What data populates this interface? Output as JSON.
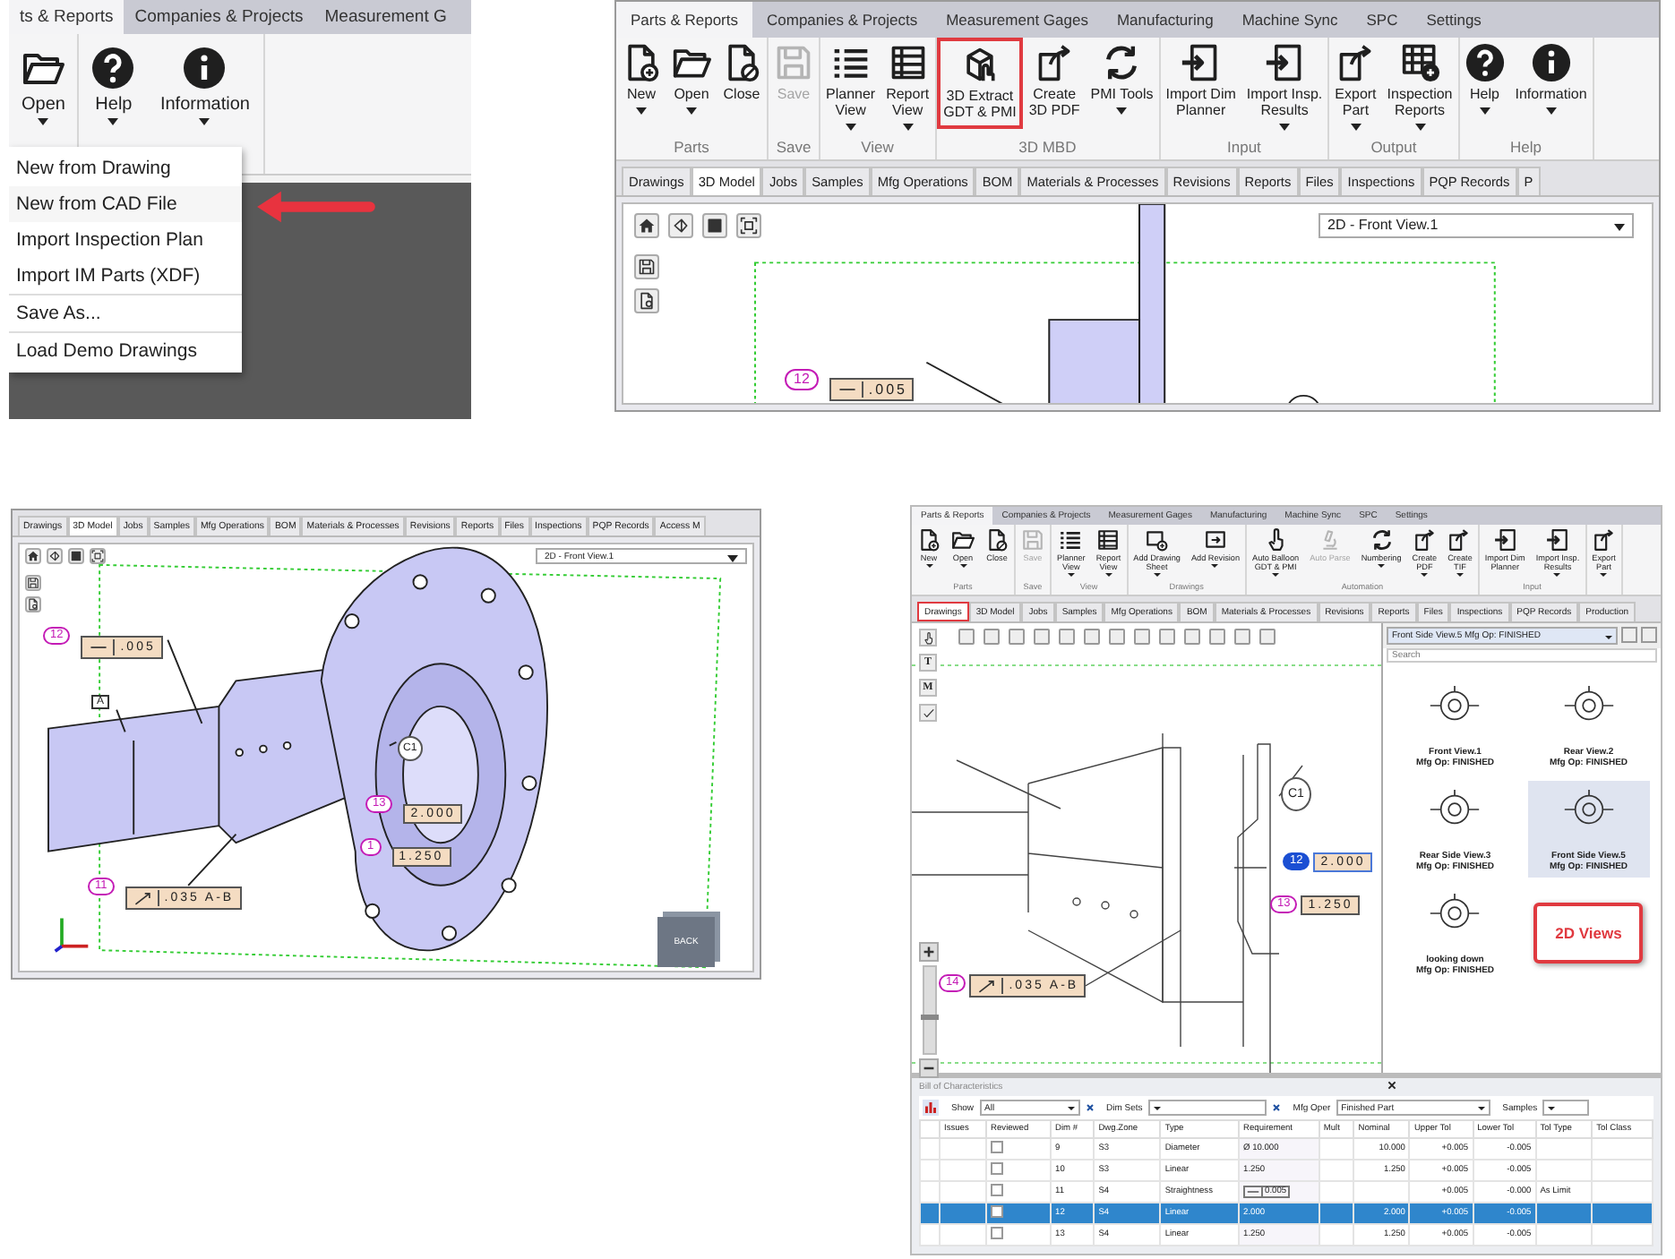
{
  "menu_panel": {
    "tabs": [
      {
        "label": "ts & Reports",
        "selected": true
      },
      {
        "label": "Companies & Projects",
        "selected": false
      },
      {
        "label": "Measurement G",
        "selected": false
      }
    ],
    "groups": [
      {
        "buttons": [
          {
            "label": "Open",
            "kind": "open",
            "caret": true
          }
        ]
      },
      {
        "buttons": [
          {
            "label": "Help",
            "kind": "help",
            "caret": true
          },
          {
            "label": "Information",
            "kind": "info",
            "caret": true
          }
        ]
      }
    ],
    "menu": [
      [
        {
          "label": "New from Drawing",
          "pointed": false
        },
        {
          "label": "New from CAD File",
          "pointed": true
        },
        {
          "label": "Import Inspection Plan",
          "pointed": false
        },
        {
          "label": "Import IM Parts (XDF)",
          "pointed": false
        }
      ],
      [
        {
          "label": "Save As...",
          "pointed": false
        }
      ],
      [
        {
          "label": "Load Demo Drawings",
          "pointed": false
        }
      ]
    ]
  },
  "ribbon_panel": {
    "tabs": [
      {
        "label": "Parts & Reports",
        "selected": true
      },
      {
        "label": "Companies & Projects",
        "selected": false
      },
      {
        "label": "Measurement Gages",
        "selected": false
      },
      {
        "label": "Manufacturing",
        "selected": false
      },
      {
        "label": "Machine Sync",
        "selected": false
      },
      {
        "label": "SPC",
        "selected": false
      },
      {
        "label": "Settings",
        "selected": false
      }
    ],
    "groups": [
      {
        "label": "Parts",
        "buttons": [
          {
            "label": "New",
            "kind": "new",
            "caret": true,
            "disabled": false,
            "highlighted": false
          },
          {
            "label": "Open",
            "kind": "open",
            "caret": true,
            "disabled": false,
            "highlighted": false
          },
          {
            "label": "Close",
            "kind": "close",
            "caret": false,
            "disabled": false,
            "highlighted": false
          }
        ]
      },
      {
        "label": "Save",
        "buttons": [
          {
            "label": "Save",
            "kind": "save",
            "caret": false,
            "disabled": true,
            "highlighted": false
          }
        ]
      },
      {
        "label": "View",
        "buttons": [
          {
            "label": "Planner\nView",
            "kind": "list",
            "caret": true,
            "disabled": false,
            "highlighted": false
          },
          {
            "label": "Report\nView",
            "kind": "table",
            "caret": true,
            "disabled": false,
            "highlighted": false
          }
        ]
      },
      {
        "label": "3D MBD",
        "buttons": [
          {
            "label": "3D Extract\nGDT & PMI",
            "kind": "cube",
            "caret": false,
            "disabled": false,
            "highlighted": true
          },
          {
            "label": "Create\n3D PDF",
            "kind": "export",
            "caret": false,
            "disabled": false,
            "highlighted": false
          },
          {
            "label": "PMI Tools",
            "kind": "cycle",
            "caret": true,
            "disabled": false,
            "highlighted": false
          }
        ]
      },
      {
        "label": "Input",
        "buttons": [
          {
            "label": "Import Dim\nPlanner",
            "kind": "import",
            "caret": false,
            "disabled": false,
            "highlighted": false
          },
          {
            "label": "Import Insp.\nResults",
            "kind": "import",
            "caret": true,
            "disabled": false,
            "highlighted": false
          }
        ]
      },
      {
        "label": "Output",
        "buttons": [
          {
            "label": "Export\nPart",
            "kind": "export",
            "caret": true,
            "disabled": false,
            "highlighted": false
          },
          {
            "label": "Inspection\nReports",
            "kind": "tableplus",
            "caret": true,
            "disabled": false,
            "highlighted": false
          }
        ]
      },
      {
        "label": "Help",
        "buttons": [
          {
            "label": "Help",
            "kind": "help",
            "caret": true,
            "disabled": false,
            "highlighted": false
          },
          {
            "label": "Information",
            "kind": "info",
            "caret": true,
            "disabled": false,
            "highlighted": false
          }
        ]
      }
    ],
    "doc_tabs": [
      {
        "label": "Drawings",
        "selected": false
      },
      {
        "label": "3D Model",
        "selected": true
      },
      {
        "label": "Jobs",
        "selected": false
      },
      {
        "label": "Samples",
        "selected": false
      },
      {
        "label": "Mfg Operations",
        "selected": false
      },
      {
        "label": "BOM",
        "selected": false
      },
      {
        "label": "Materials & Processes",
        "selected": false
      },
      {
        "label": "Revisions",
        "selected": false
      },
      {
        "label": "Reports",
        "selected": false
      },
      {
        "label": "Files",
        "selected": false
      },
      {
        "label": "Inspections",
        "selected": false
      },
      {
        "label": "PQP Records",
        "selected": false
      },
      {
        "label": "P",
        "selected": false
      }
    ],
    "view_select": "2D - Front View.1",
    "annotations": [
      {
        "balloon": "12",
        "kind": "straightness",
        "value": ".005",
        "selected": false
      }
    ]
  },
  "model_panel": {
    "doc_tabs": [
      {
        "label": "Drawings",
        "selected": false
      },
      {
        "label": "3D Model",
        "selected": true
      },
      {
        "label": "Jobs",
        "selected": false
      },
      {
        "label": "Samples",
        "selected": false
      },
      {
        "label": "Mfg Operations",
        "selected": false
      },
      {
        "label": "BOM",
        "selected": false
      },
      {
        "label": "Materials & Processes",
        "selected": false
      },
      {
        "label": "Revisions",
        "selected": false
      },
      {
        "label": "Reports",
        "selected": false
      },
      {
        "label": "Files",
        "selected": false
      },
      {
        "label": "Inspections",
        "selected": false
      },
      {
        "label": "PQP Records",
        "selected": false
      },
      {
        "label": "Access M",
        "selected": false
      }
    ],
    "view_select": "2D - Front View.1",
    "annotations": [
      {
        "balloon": "12",
        "kind": "straightness",
        "value": ".005",
        "selected": false
      },
      {
        "balloon": "13",
        "kind": "dimension",
        "value": "2.000",
        "selected": false
      },
      {
        "balloon": "1",
        "kind": "dimension",
        "value": "1.250",
        "selected": false
      },
      {
        "balloon": "11",
        "kind": "runout",
        "value": ".035 A-B",
        "selected": false
      }
    ],
    "datum": "A",
    "feature_label": "C1",
    "view_cube": "BACK"
  },
  "drawings_panel": {
    "tabs": [
      {
        "label": "Parts & Reports",
        "selected": true
      },
      {
        "label": "Companies & Projects",
        "selected": false
      },
      {
        "label": "Measurement Gages",
        "selected": false
      },
      {
        "label": "Manufacturing",
        "selected": false
      },
      {
        "label": "Machine Sync",
        "selected": false
      },
      {
        "label": "SPC",
        "selected": false
      },
      {
        "label": "Settings",
        "selected": false
      }
    ],
    "groups": [
      {
        "label": "Parts",
        "buttons": [
          {
            "label": "New",
            "kind": "new",
            "caret": true,
            "disabled": false
          },
          {
            "label": "Open",
            "kind": "open",
            "caret": true,
            "disabled": false
          },
          {
            "label": "Close",
            "kind": "close",
            "caret": false,
            "disabled": false
          }
        ]
      },
      {
        "label": "Save",
        "buttons": [
          {
            "label": "Save",
            "kind": "save",
            "caret": false,
            "disabled": true
          }
        ]
      },
      {
        "label": "View",
        "buttons": [
          {
            "label": "Planner\nView",
            "kind": "list",
            "caret": true,
            "disabled": false
          },
          {
            "label": "Report\nView",
            "kind": "table",
            "caret": true,
            "disabled": false
          }
        ]
      },
      {
        "label": "Drawings",
        "buttons": [
          {
            "label": "Add Drawing\nSheet",
            "kind": "sheet",
            "caret": true,
            "disabled": false
          },
          {
            "label": "Add Revision",
            "kind": "revision",
            "caret": true,
            "disabled": false
          }
        ]
      },
      {
        "label": "Automation",
        "buttons": [
          {
            "label": "Auto Balloon\nGDT & PMI",
            "kind": "pointer",
            "caret": true,
            "disabled": false
          },
          {
            "label": "Auto Parse",
            "kind": "microscope",
            "caret": false,
            "disabled": true
          },
          {
            "label": "Numbering",
            "kind": "cycle",
            "caret": true,
            "disabled": false
          },
          {
            "label": "Create\nPDF",
            "kind": "export",
            "caret": true,
            "disabled": false
          },
          {
            "label": "Create\nTIF",
            "kind": "export",
            "caret": true,
            "disabled": false
          }
        ]
      },
      {
        "label": "Input",
        "buttons": [
          {
            "label": "Import Dim\nPlanner",
            "kind": "import",
            "caret": false,
            "disabled": false
          },
          {
            "label": "Import Insp.\nResults",
            "kind": "import",
            "caret": true,
            "disabled": false
          }
        ]
      },
      {
        "buttons": [
          {
            "label": "Export\nPart",
            "kind": "export",
            "caret": true,
            "disabled": false
          }
        ]
      }
    ],
    "doc_tabs": [
      {
        "label": "Drawings",
        "selected": true,
        "highlighted": true
      },
      {
        "label": "3D Model",
        "selected": false,
        "highlighted": false
      },
      {
        "label": "Jobs",
        "selected": false,
        "highlighted": false
      },
      {
        "label": "Samples",
        "selected": false,
        "highlighted": false
      },
      {
        "label": "Mfg Operations",
        "selected": false,
        "highlighted": false
      },
      {
        "label": "BOM",
        "selected": false,
        "highlighted": false
      },
      {
        "label": "Materials & Processes",
        "selected": false,
        "highlighted": false
      },
      {
        "label": "Revisions",
        "selected": false,
        "highlighted": false
      },
      {
        "label": "Reports",
        "selected": false,
        "highlighted": false
      },
      {
        "label": "Files",
        "selected": false,
        "highlighted": false
      },
      {
        "label": "Inspections",
        "selected": false,
        "highlighted": false
      },
      {
        "label": "PQP Records",
        "selected": false,
        "highlighted": false
      },
      {
        "label": "Production",
        "selected": false,
        "highlighted": false
      }
    ],
    "side_tools": [
      {
        "kind": "pointer"
      },
      {
        "kind": "glyph",
        "glyph": "T"
      },
      {
        "kind": "glyph",
        "glyph": "M"
      },
      {
        "kind": "check"
      }
    ],
    "zoom": {
      "level": 0.42
    },
    "annotations": [
      {
        "balloon": "12",
        "kind": "dimension",
        "value": "2.000",
        "selected": true
      },
      {
        "balloon": "13",
        "kind": "dimension",
        "value": "1.250",
        "selected": false
      },
      {
        "balloon": "14",
        "kind": "runout",
        "value": ".035 A-B",
        "selected": false
      }
    ],
    "feature_label": "C1",
    "views": {
      "select": "Front Side View.5 Mfg Op: FINISHED",
      "search": {
        "placeholder": "Search"
      },
      "items": [
        {
          "title": "Front View.1",
          "op": "Mfg Op: FINISHED",
          "selected": false
        },
        {
          "title": "Rear View.2",
          "op": "Mfg Op: FINISHED",
          "selected": false
        },
        {
          "title": "Rear Side View.3",
          "op": "Mfg Op: FINISHED",
          "selected": false
        },
        {
          "title": "Front Side View.5",
          "op": "Mfg Op: FINISHED",
          "selected": true
        },
        {
          "title": "looking down",
          "op": "Mfg Op: FINISHED",
          "selected": false
        }
      ],
      "callout": "2D Views"
    },
    "boc": {
      "title": "Bill of Characteristics",
      "filters": [
        {
          "label": "Show",
          "value": "All",
          "clear": true
        },
        {
          "label": "Dim Sets",
          "clear": true
        },
        {
          "label": "Mfg Oper",
          "value": "Finished Part",
          "clear": false
        },
        {
          "label": "Samples",
          "clear": false
        }
      ],
      "columns": [
        "Issues",
        "Reviewed",
        "Dim #",
        "Dwg.Zone",
        "Type",
        "Requirement",
        "Mult",
        "Nominal",
        "Upper Tol",
        "Lower Tol",
        "Tol Type",
        "Tol Class"
      ],
      "rows": [
        {
          "reviewed": false,
          "dim": "9",
          "zone": "S3",
          "type": "Diameter",
          "requirement": "Ø 10.000",
          "frame": false,
          "nominal": "10.000",
          "upper": "+0.005",
          "lower": "-0.005",
          "selected": false
        },
        {
          "reviewed": false,
          "dim": "10",
          "zone": "S3",
          "type": "Linear",
          "requirement": "1.250",
          "frame": false,
          "nominal": "1.250",
          "upper": "+0.005",
          "lower": "-0.005",
          "selected": false
        },
        {
          "reviewed": false,
          "dim": "11",
          "zone": "S4",
          "type": "Straightness",
          "requirement": "0.005",
          "frame": true,
          "upper": "+0.005",
          "lower": "-0.000",
          "tol_type": "As Limit",
          "selected": false
        },
        {
          "reviewed": false,
          "dim": "12",
          "zone": "S4",
          "type": "Linear",
          "requirement": "2.000",
          "frame": false,
          "nominal": "2.000",
          "upper": "+0.005",
          "lower": "-0.005",
          "selected": true
        },
        {
          "reviewed": false,
          "dim": "13",
          "zone": "S4",
          "type": "Linear",
          "requirement": "1.250",
          "frame": false,
          "nominal": "1.250",
          "upper": "+0.005",
          "lower": "-0.005",
          "selected": false
        }
      ]
    }
  }
}
